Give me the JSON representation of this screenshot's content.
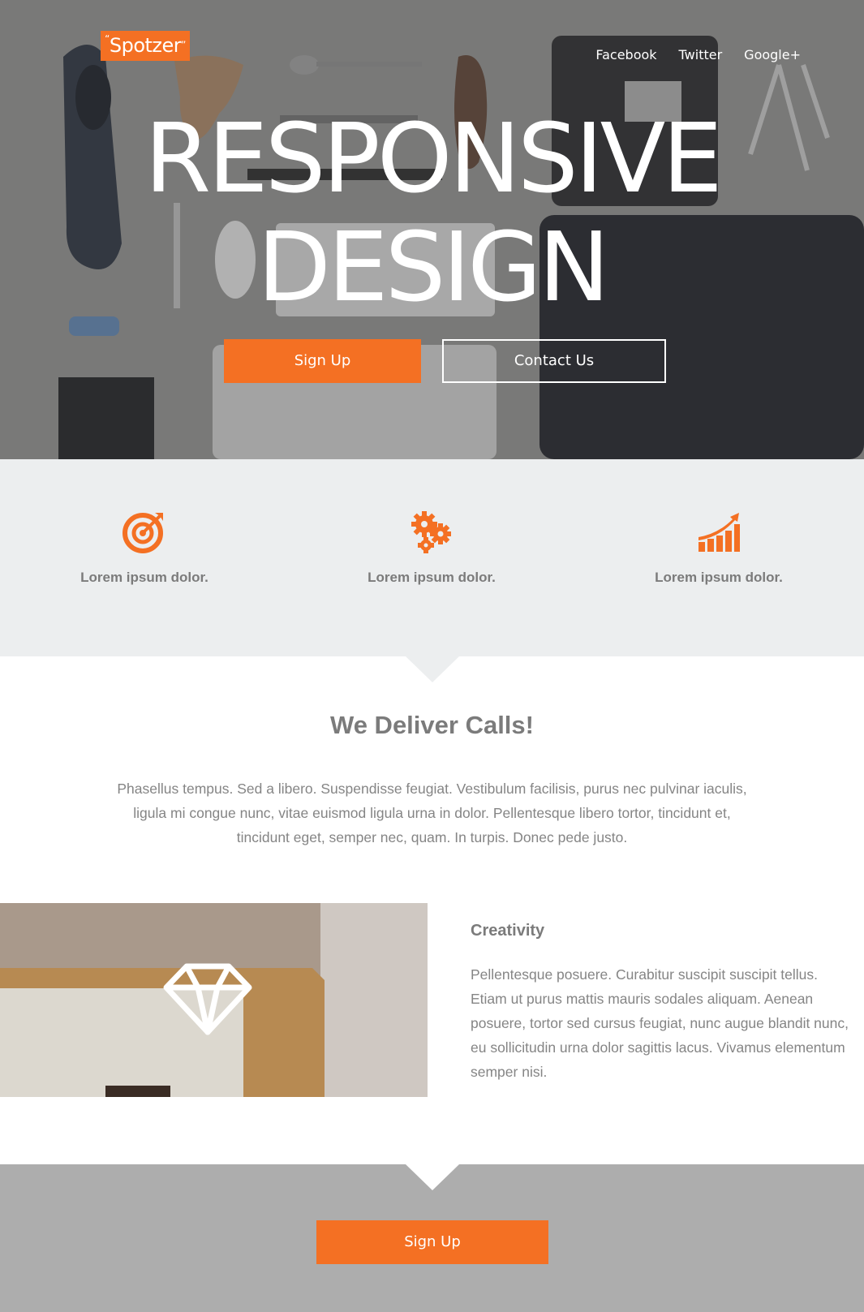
{
  "brand": {
    "logo_text": "Spotzer",
    "accent_color": "#f47023"
  },
  "social": [
    "Facebook",
    "Twitter",
    "Google+"
  ],
  "hero": {
    "title_line1": "RESPONSIVE",
    "title_line2": "DESIGN",
    "signup_label": "Sign Up",
    "contact_label": "Contact Us"
  },
  "features": [
    {
      "icon": "target-icon",
      "label": "Lorem ipsum dolor."
    },
    {
      "icon": "gears-icon",
      "label": "Lorem ipsum dolor."
    },
    {
      "icon": "growth-chart-icon",
      "label": "Lorem ipsum dolor."
    }
  ],
  "intro": {
    "title": "We Deliver Calls!",
    "text": "Phasellus tempus. Sed a libero. Suspendisse feugiat. Vestibulum facilisis, purus nec pulvinar iaculis, ligula mi congue nunc, vitae euismod ligula urna in dolor. Pellentesque libero tortor, tincidunt et, tincidunt eget, semper nec, quam. In turpis. Donec pede justo."
  },
  "creativity": {
    "icon": "diamond-icon",
    "title": "Creativity",
    "text": "Pellentesque posuere. Curabitur suscipit suscipit tellus. Etiam ut purus mattis mauris sodales aliquam. Aenean posuere, tortor sed cursus feugiat, nunc augue blandit nunc, eu sollicitudin urna dolor sagittis lacus. Vivamus elementum semper nisi."
  },
  "footer_cta": {
    "signup_label": "Sign Up"
  }
}
